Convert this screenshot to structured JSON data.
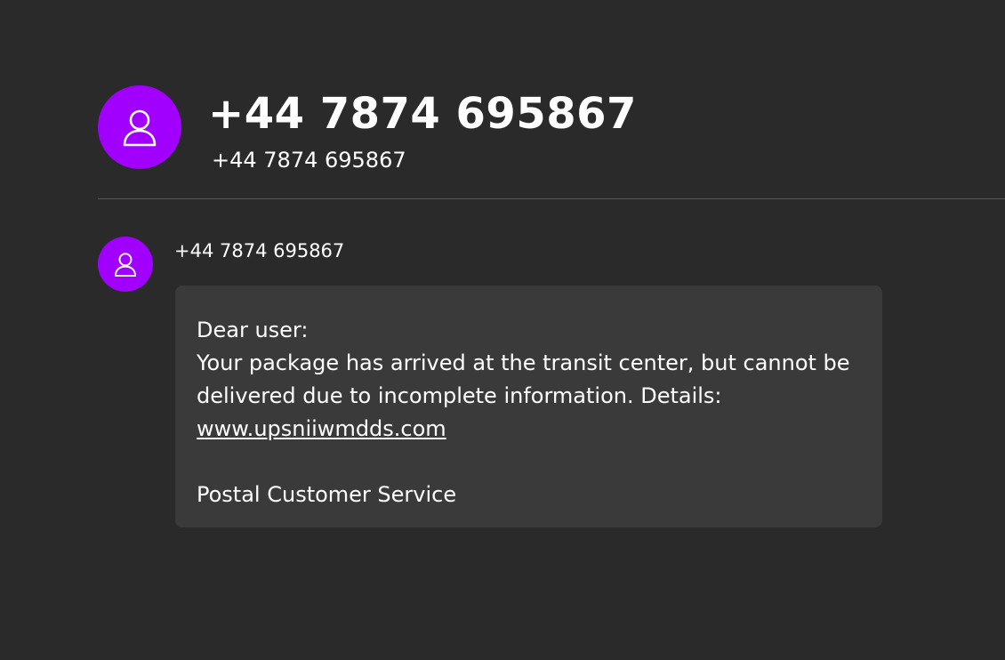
{
  "header": {
    "title": "+44 7874 695867",
    "subtitle": "+44 7874 695867",
    "avatar_icon": "person-icon"
  },
  "message": {
    "sender": "+44 7874 695867",
    "avatar_icon": "person-icon",
    "lines": {
      "greeting": "Dear user:",
      "body1": "Your package has arrived at the transit center, but cannot be",
      "body2": "delivered due to incomplete information. Details:",
      "link": "www.upsniiwmdds.com",
      "signature": "Postal Customer Service"
    }
  },
  "colors": {
    "background": "#2a2a2a",
    "bubble": "#3a3a3a",
    "avatar": "#a100ff",
    "text": "#ffffff"
  }
}
